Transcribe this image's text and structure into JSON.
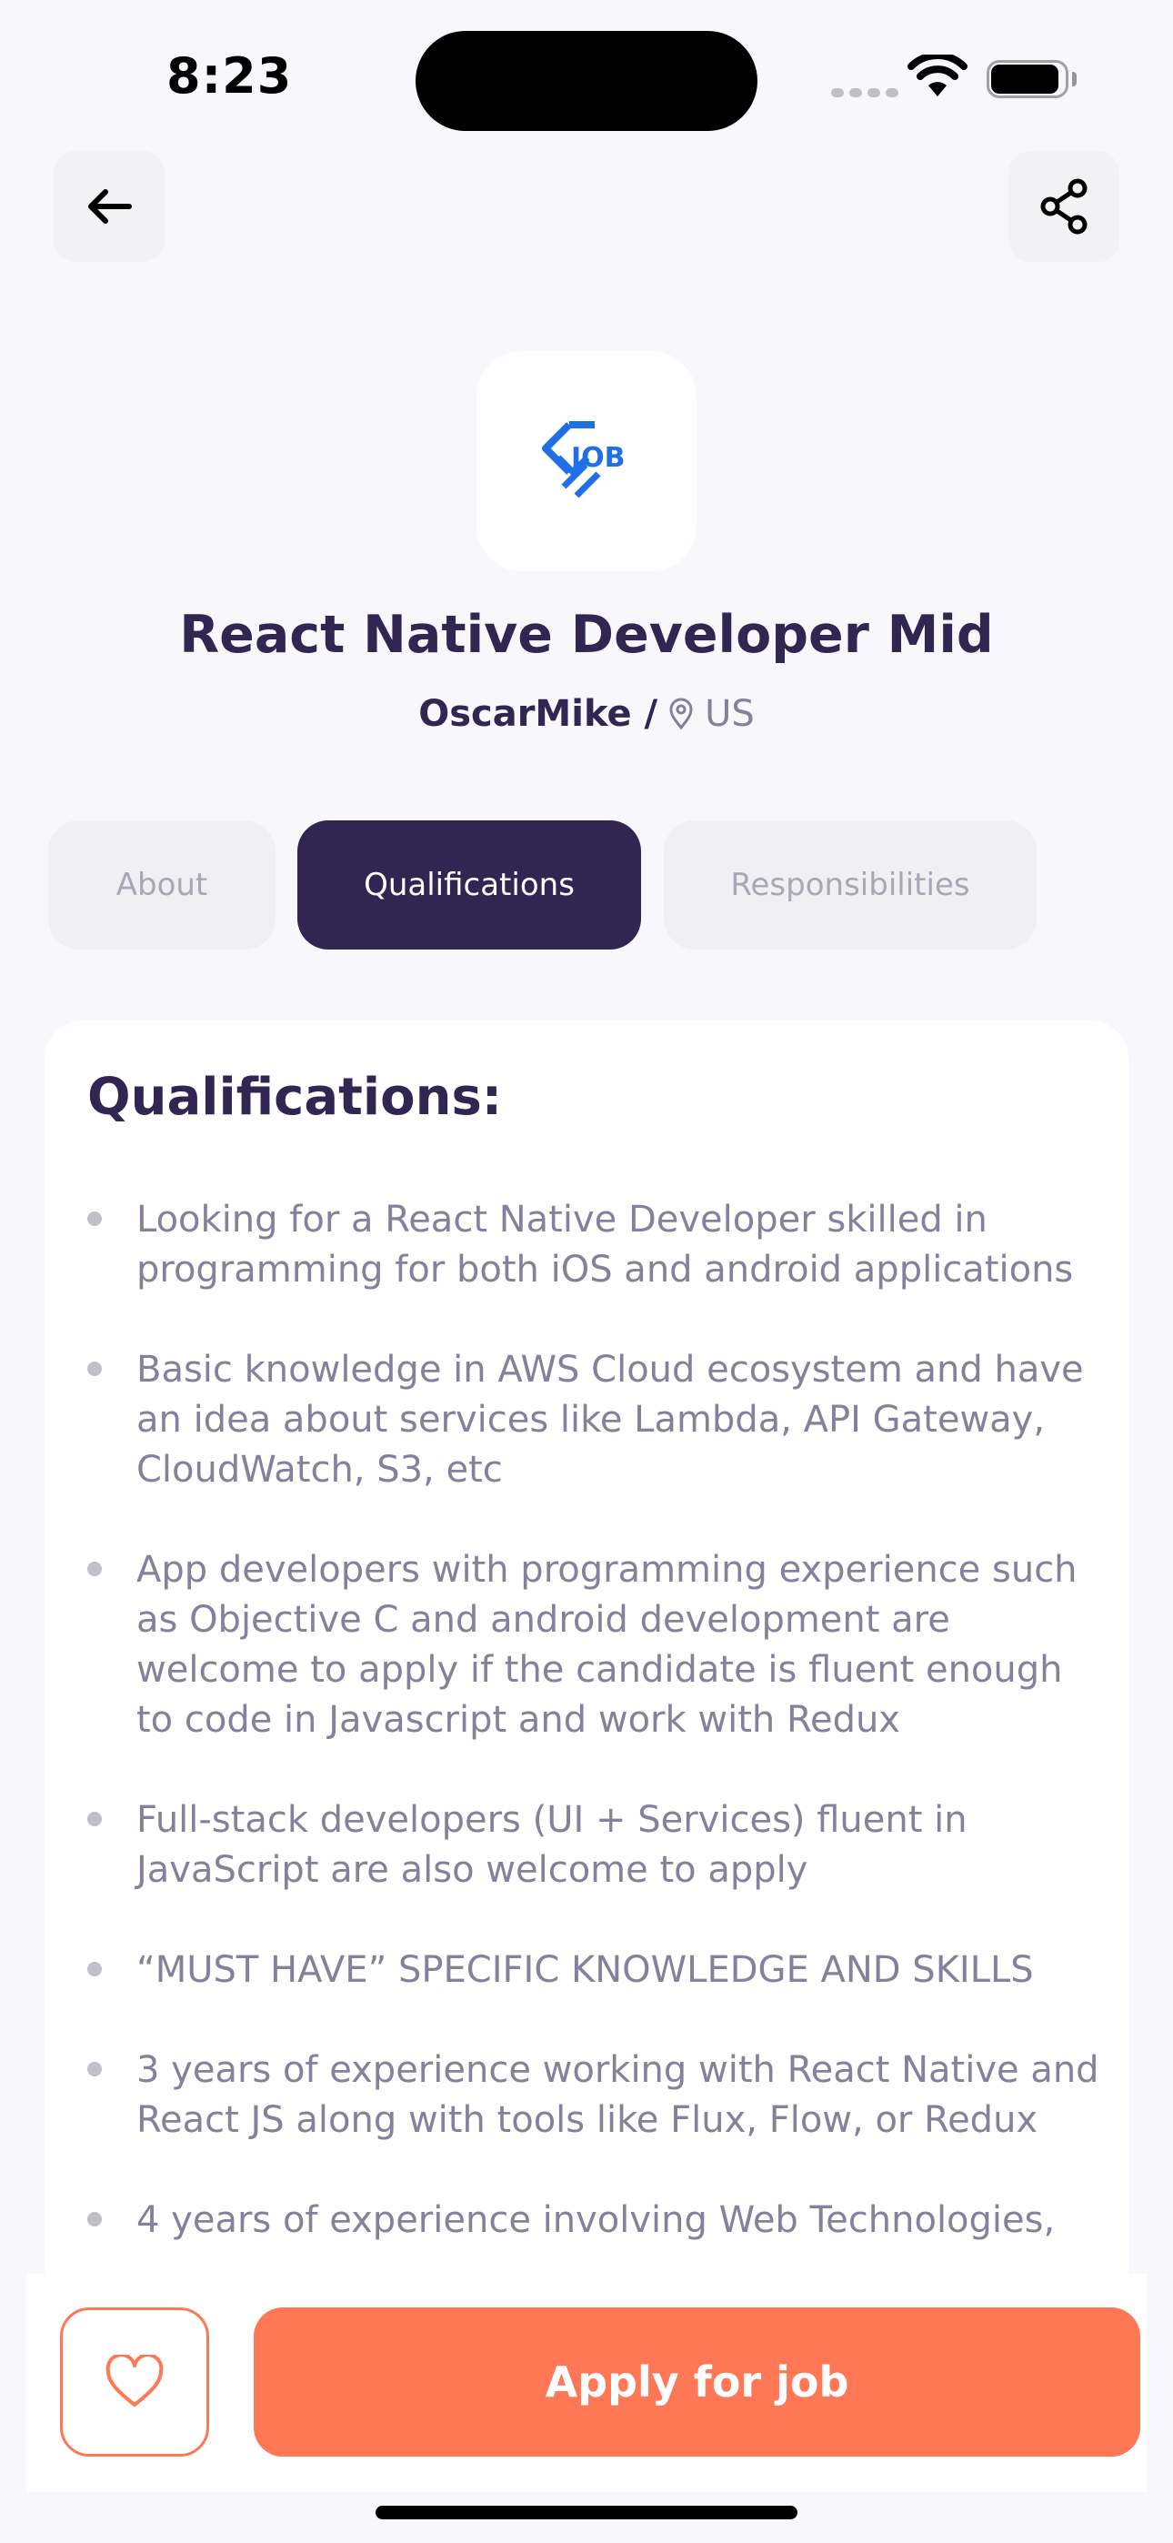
{
  "status_bar": {
    "time": "8:23",
    "icons": [
      "cellular-signal-icon",
      "wifi-icon",
      "battery-icon"
    ]
  },
  "header": {
    "back_icon": "arrow-left-icon",
    "share_icon": "share-icon"
  },
  "job": {
    "logo_text": "JOB",
    "title": "React Native Developer Mid",
    "company": "OscarMike /",
    "location": "US"
  },
  "tabs": [
    {
      "label": "About",
      "active": false
    },
    {
      "label": "Qualifications",
      "active": true
    },
    {
      "label": "Responsibilities",
      "active": false
    }
  ],
  "qualifications": {
    "heading": "Qualifications:",
    "items": [
      "Looking for a React Native Developer skilled in programming for both iOS and android applications",
      "Basic knowledge in AWS Cloud ecosystem and have an idea about services like Lambda, API Gateway, CloudWatch, S3, etc",
      "App developers with programming experience such as Objective C and android development are welcome to apply if the candidate is fluent enough to code in Javascript and work with Redux",
      "Full-stack developers (UI + Services) fluent in JavaScript are also welcome to apply",
      "“MUST HAVE” SPECIFIC KNOWLEDGE AND SKILLS",
      "3 years of experience working with React Native and React JS along with tools like Flux, Flow, or Redux",
      "4 years of experience involving Web Technologies,"
    ]
  },
  "footer": {
    "like_icon": "heart-icon",
    "apply_label": "Apply for job"
  },
  "colors": {
    "primary": "#312651",
    "accent": "#FF7754",
    "background": "#F8F8FC",
    "muted_text": "#83829A",
    "logo_blue": "#1F6FE8"
  }
}
